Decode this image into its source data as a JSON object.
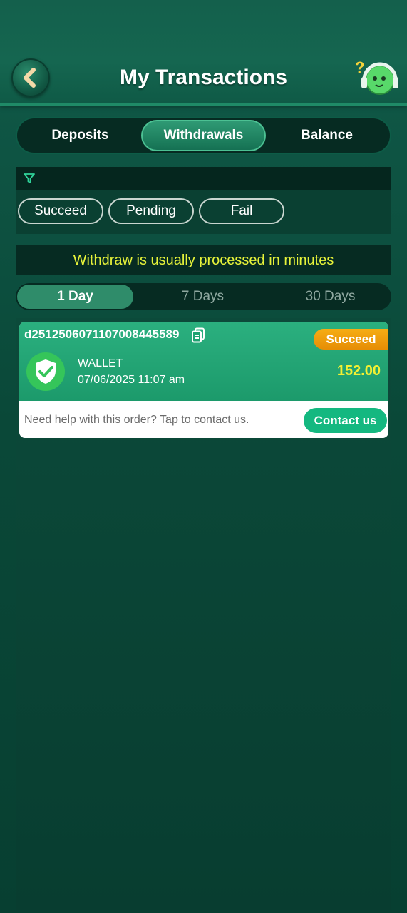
{
  "header": {
    "title": "My Transactions",
    "back_icon": "chevron-left-icon",
    "help_icon": "support-headset-mascot-icon"
  },
  "tabs": [
    {
      "label": "Deposits",
      "active": false
    },
    {
      "label": "Withdrawals",
      "active": true
    },
    {
      "label": "Balance",
      "active": false
    }
  ],
  "filter": {
    "icon": "filter-icon",
    "chips": [
      "Succeed",
      "Pending",
      "Fail"
    ]
  },
  "notice": "Withdraw is usually processed in minutes",
  "day_tabs": [
    {
      "label": "1 Day",
      "active": true
    },
    {
      "label": "7 Days",
      "active": false
    },
    {
      "label": "30 Days",
      "active": false
    }
  ],
  "transactions": [
    {
      "order_id": "d2512506071107008445589",
      "status": "Succeed",
      "method": "WALLET",
      "datetime": "07/06/2025 11:07 am",
      "amount": "152.00",
      "help_text": "Need help with this order? Tap to contact us.",
      "contact_label": "Contact us"
    }
  ],
  "colors": {
    "accent": "#2bb07f",
    "status_succeed": "#f0a00c",
    "amount": "#f3f032",
    "notice_text": "#e6f23a"
  }
}
